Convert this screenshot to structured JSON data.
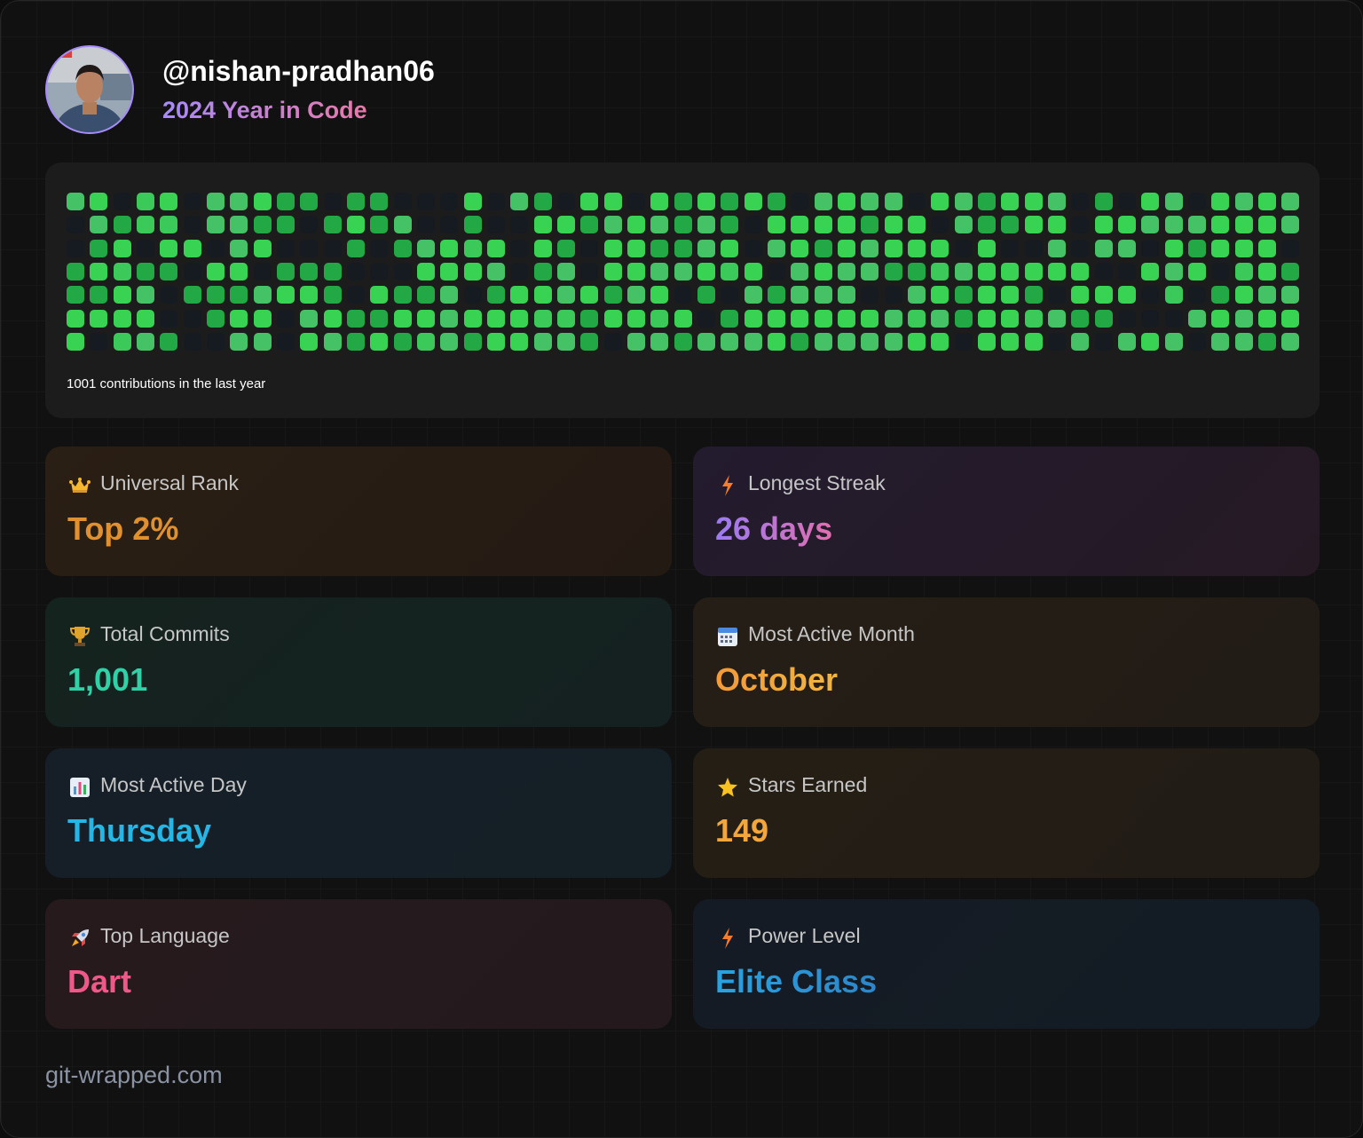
{
  "profile": {
    "username": "@nishan-pradhan06",
    "subtitle": "2024 Year in Code"
  },
  "contributions": {
    "caption": "1001 contributions in the last year",
    "weeks": 53,
    "days": 7,
    "levels": [
      "30011222312120012422444013232421001002010033021103332123212032311012001001232010112312100111100212",
      "03101210032124002233321420210023122300022212212430213343210021123221200222323231324311130212332103",
      "11240132002323123012202233213212323222332331330233221033022134220242323303110112222221022222202142",
      "32320300002213123021002302032302002332340303120302220123322423322223213301323103231320010220302301",
      "00100112022102223323220433231322012101333213003121212120032221220302241040300301001200022322110003"
    ]
  },
  "stats": [
    {
      "id": "universal-rank",
      "label": "Universal Rank",
      "value": "Top 2%",
      "icon": "crown-icon",
      "color": "#e0902f"
    },
    {
      "id": "longest-streak",
      "label": "Longest Streak",
      "value": "26 days",
      "icon": "lightning-icon",
      "color": "#b07bf0"
    },
    {
      "id": "total-commits",
      "label": "Total Commits",
      "value": "1,001",
      "icon": "trophy-icon",
      "color": "#2fd1a6"
    },
    {
      "id": "most-active-month",
      "label": "Most Active Month",
      "value": "October",
      "icon": "calendar-icon",
      "color": "#f0a040"
    },
    {
      "id": "most-active-day",
      "label": "Most Active Day",
      "value": "Thursday",
      "icon": "bar-chart-icon",
      "color": "#26b6e6"
    },
    {
      "id": "stars-earned",
      "label": "Stars Earned",
      "value": "149",
      "icon": "star-icon",
      "color": "#f2a63c"
    },
    {
      "id": "top-language",
      "label": "Top Language",
      "value": "Dart",
      "icon": "rocket-icon",
      "color": "#f0588a"
    },
    {
      "id": "power-level",
      "label": "Power Level",
      "value": "Elite Class",
      "icon": "lightning-icon",
      "color": "#29a3e0"
    }
  ],
  "footer": {
    "site": "git-wrapped.com"
  }
}
